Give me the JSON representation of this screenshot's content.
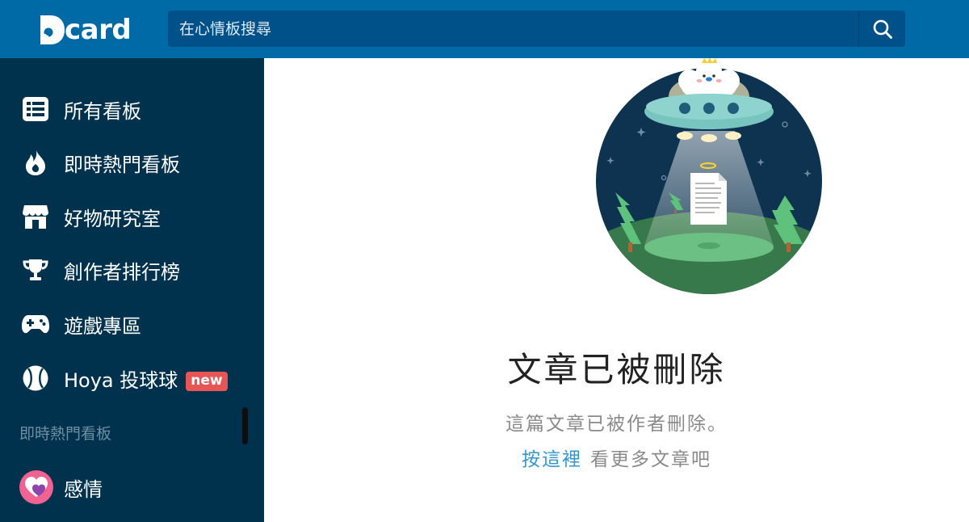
{
  "colors": {
    "brand": "#006aa6",
    "sidebar": "#00324e",
    "link": "#3397cf",
    "badge": "#e75656"
  },
  "header": {
    "logo_text": "card",
    "search_placeholder": "在心情板搜尋",
    "search_icon": "search-icon"
  },
  "sidebar": {
    "items": [
      {
        "label": "所有看板",
        "icon": "list-icon"
      },
      {
        "label": "即時熱門看板",
        "icon": "flame-icon"
      },
      {
        "label": "好物研究室",
        "icon": "shop-icon"
      },
      {
        "label": "創作者排行榜",
        "icon": "trophy-icon"
      },
      {
        "label": "遊戲專區",
        "icon": "gamepad-icon"
      },
      {
        "label": "Hoya 投球球",
        "icon": "baseball-icon",
        "badge": "new"
      }
    ],
    "section_title": "即時熱門看板",
    "forums": [
      {
        "label": "感情",
        "icon": "heart-avatar-icon"
      }
    ]
  },
  "main": {
    "title": "文章已被刪除",
    "subtitle": "這篇文章已被作者刪除。",
    "link_text": "按這裡",
    "link_suffix": "看更多文章吧"
  }
}
